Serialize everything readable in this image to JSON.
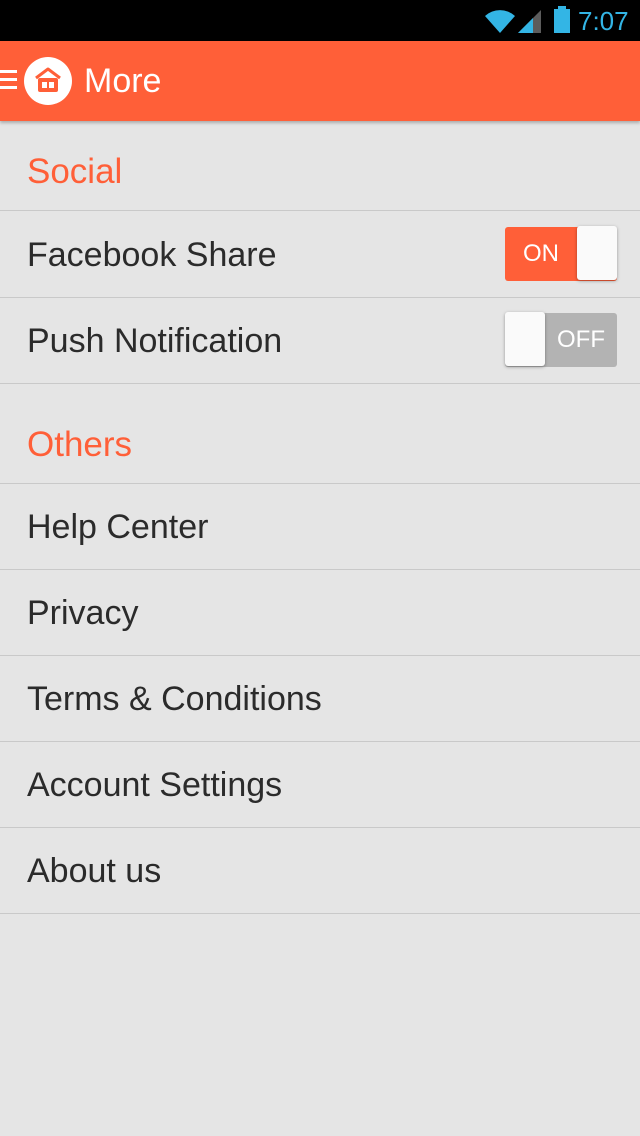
{
  "status_bar": {
    "time": "7:07",
    "icons": [
      "wifi-icon",
      "signal-icon",
      "battery-icon"
    ],
    "time_color": "#33b5e5"
  },
  "action_bar": {
    "title": "More",
    "menu_icon": "menu-icon",
    "logo_icon": "app-logo-icon",
    "color": "#ff5f38"
  },
  "sections": [
    {
      "header": "Social",
      "items": [
        {
          "label": "Facebook Share",
          "toggle": {
            "state": "on",
            "text": "ON"
          }
        },
        {
          "label": "Push Notification",
          "toggle": {
            "state": "off",
            "text": "OFF"
          }
        }
      ]
    },
    {
      "header": "Others",
      "items": [
        {
          "label": "Help Center"
        },
        {
          "label": "Privacy"
        },
        {
          "label": "Terms & Conditions"
        },
        {
          "label": "Account Settings"
        },
        {
          "label": "About us"
        }
      ]
    }
  ]
}
